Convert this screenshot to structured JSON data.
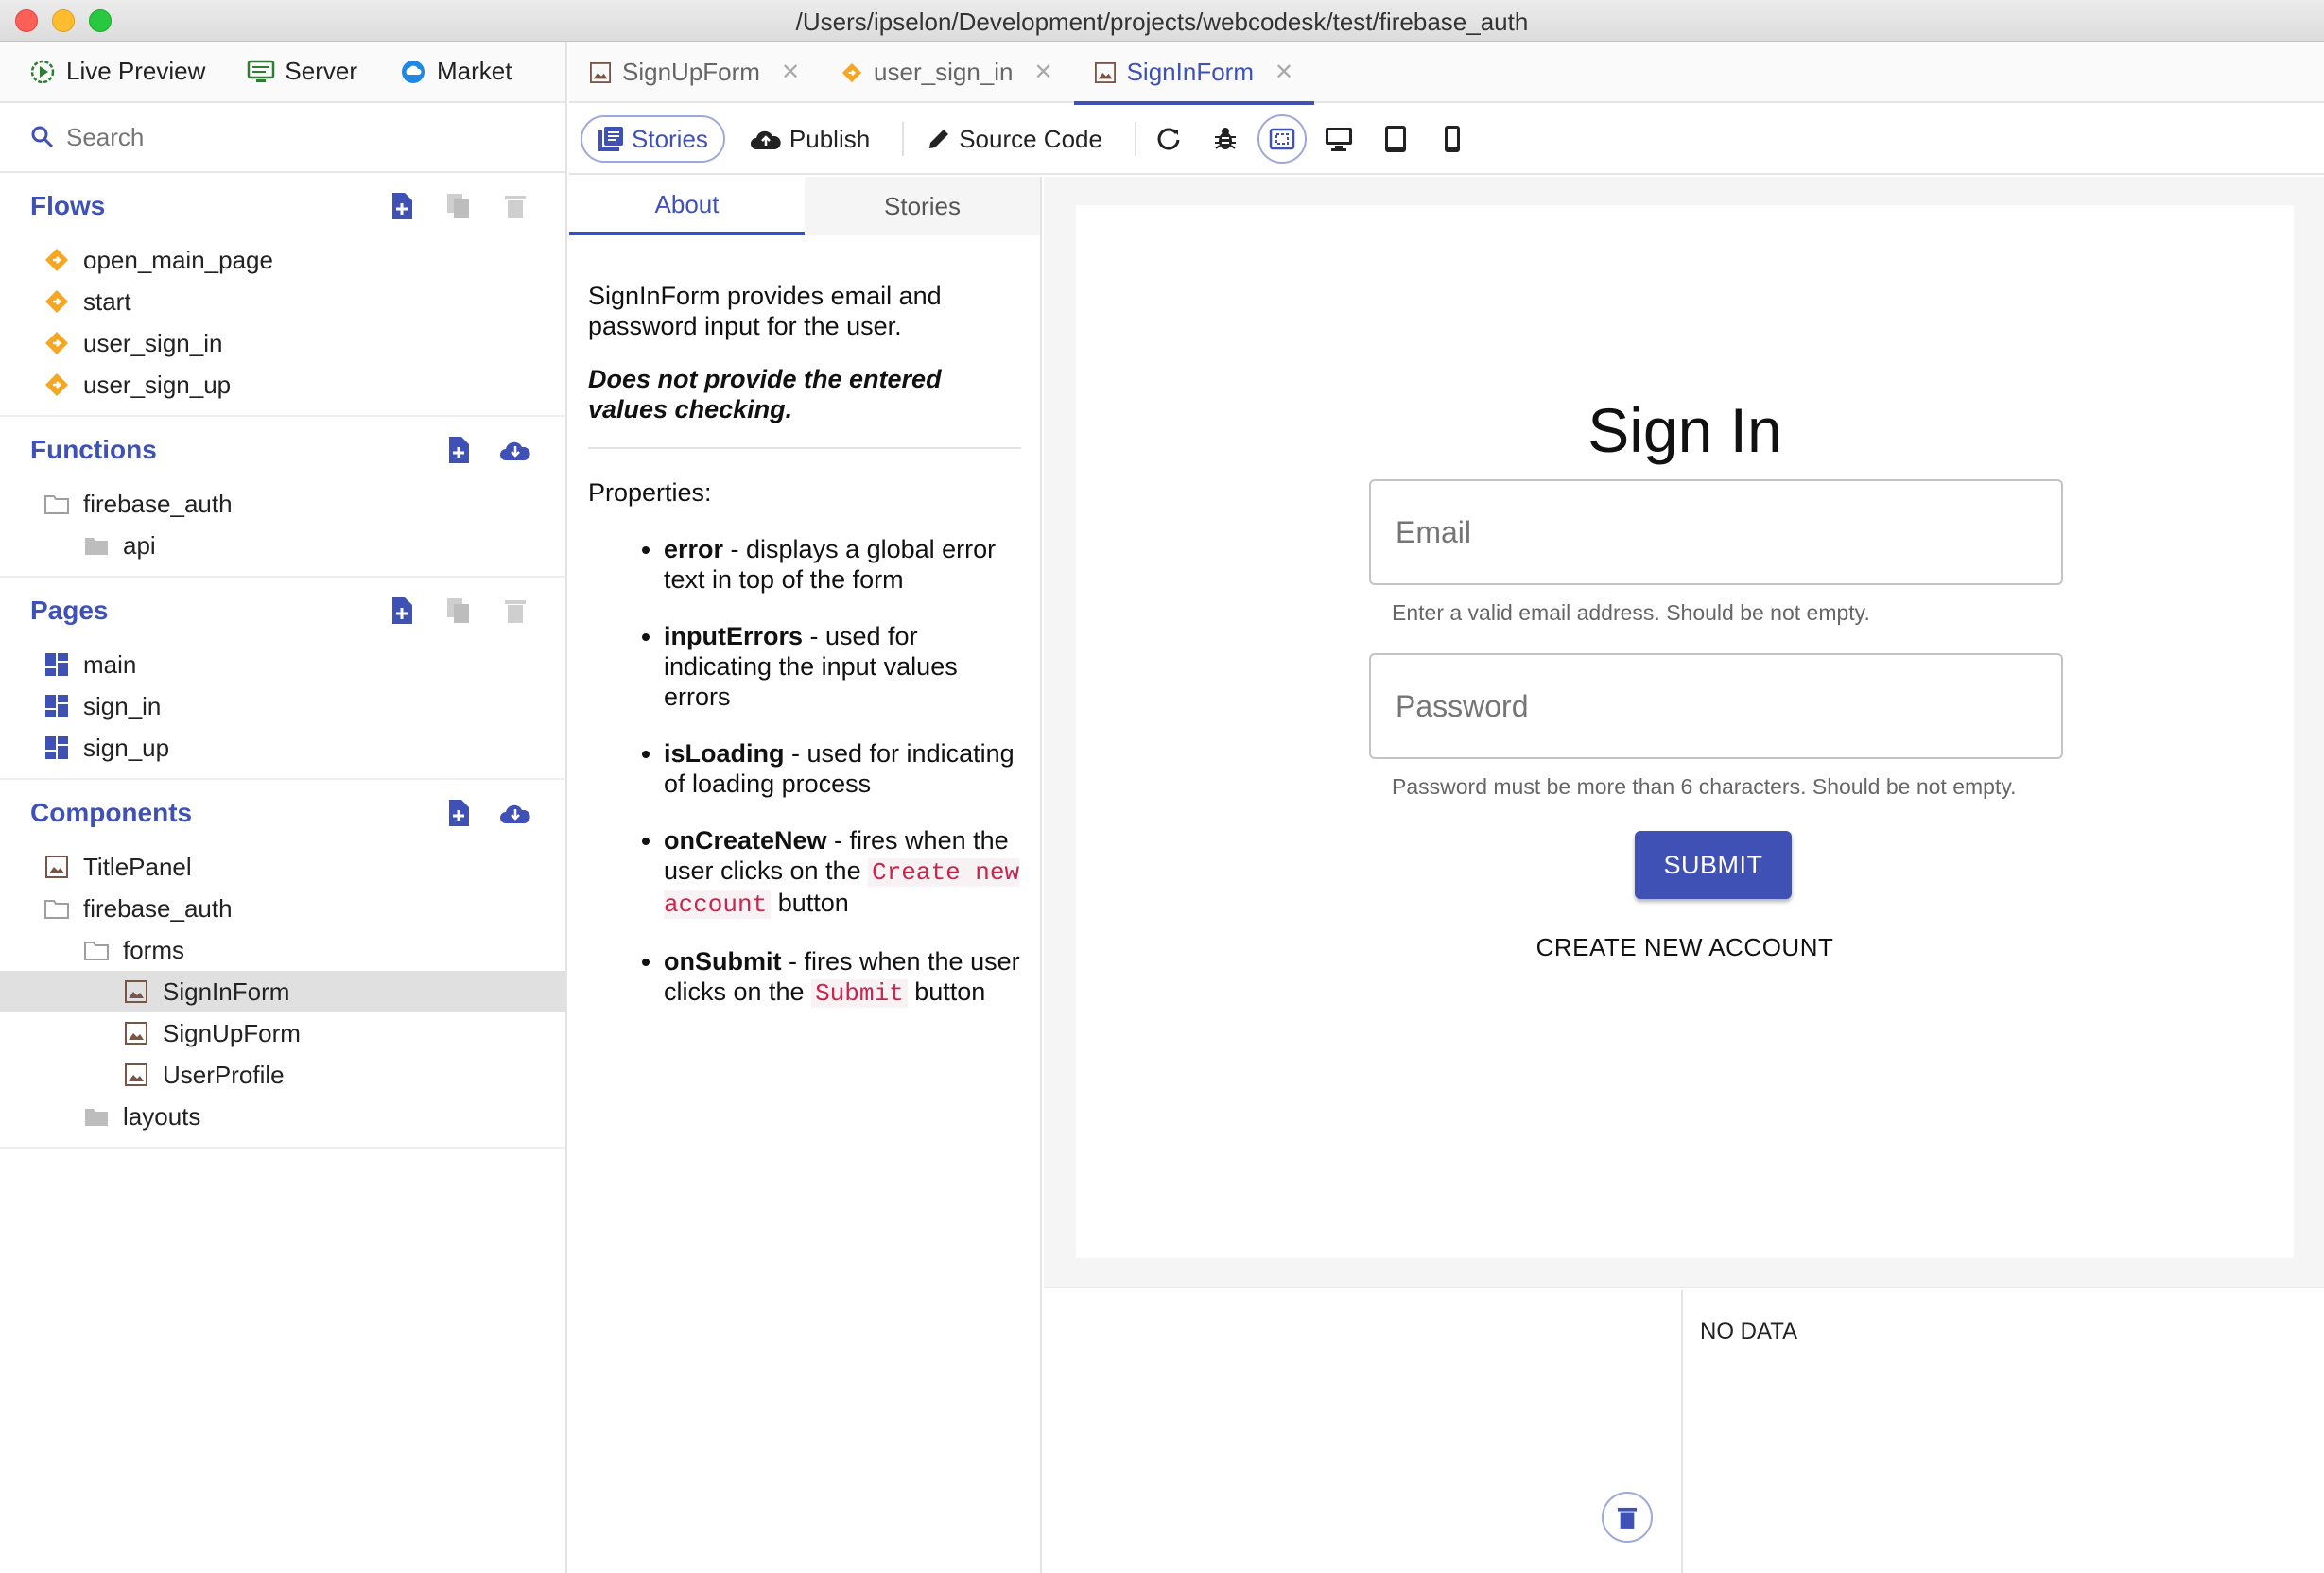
{
  "window": {
    "title": "/Users/ipselon/Development/projects/webcodesk/test/firebase_auth"
  },
  "topnav": {
    "live_preview": "Live Preview",
    "server": "Server",
    "market": "Market"
  },
  "search": {
    "placeholder": "Search"
  },
  "sidebar": {
    "flows": {
      "title": "Flows",
      "items": [
        "open_main_page",
        "start",
        "user_sign_in",
        "user_sign_up"
      ]
    },
    "functions": {
      "title": "Functions",
      "folder": "firebase_auth",
      "subfolder": "api"
    },
    "pages": {
      "title": "Pages",
      "items": [
        "main",
        "sign_in",
        "sign_up"
      ]
    },
    "components": {
      "title": "Components",
      "title_panel": "TitlePanel",
      "folder": "firebase_auth",
      "forms_folder": "forms",
      "forms": [
        "SignInForm",
        "SignUpForm",
        "UserProfile"
      ],
      "layouts_folder": "layouts"
    }
  },
  "tabs": [
    {
      "label": "SignUpForm",
      "active": false
    },
    {
      "label": "user_sign_in",
      "active": false
    },
    {
      "label": "SignInForm",
      "active": true
    }
  ],
  "toolbar": {
    "stories": "Stories",
    "publish": "Publish",
    "source_code": "Source Code"
  },
  "docs": {
    "tab_about": "About",
    "tab_stories": "Stories",
    "intro": "SignInForm provides email and password input for the user.",
    "note": "Does not provide the entered values checking.",
    "properties_label": "Properties:",
    "props": {
      "error": {
        "name": "error",
        "desc": " - displays a global error text in top of the form"
      },
      "inputErrors": {
        "name": "inputErrors",
        "desc": " - used for indicating the input values errors"
      },
      "isLoading": {
        "name": "isLoading",
        "desc": " - used for indicating of loading process"
      },
      "onCreateNew": {
        "name": "onCreateNew",
        "desc": " - fires when the user clicks on the ",
        "code": "Create new account",
        "tail": " button"
      },
      "onSubmit": {
        "name": "onSubmit",
        "desc": " - fires when the user clicks on the ",
        "code": "Submit",
        "tail": " button"
      }
    }
  },
  "preview": {
    "title": "Sign In",
    "email_placeholder": "Email",
    "email_helper": "Enter a valid email address. Should be not empty.",
    "password_placeholder": "Password",
    "password_helper": "Password must be more than 6 characters. Should be not empty.",
    "submit": "SUBMIT",
    "create_new": "CREATE NEW ACCOUNT"
  },
  "bottom": {
    "no_data": "NO DATA"
  },
  "colors": {
    "accent": "#3f51b5",
    "flow_icon": "#f5a623",
    "selected_row": "#e0e0e0",
    "code_text": "#c7254e"
  }
}
